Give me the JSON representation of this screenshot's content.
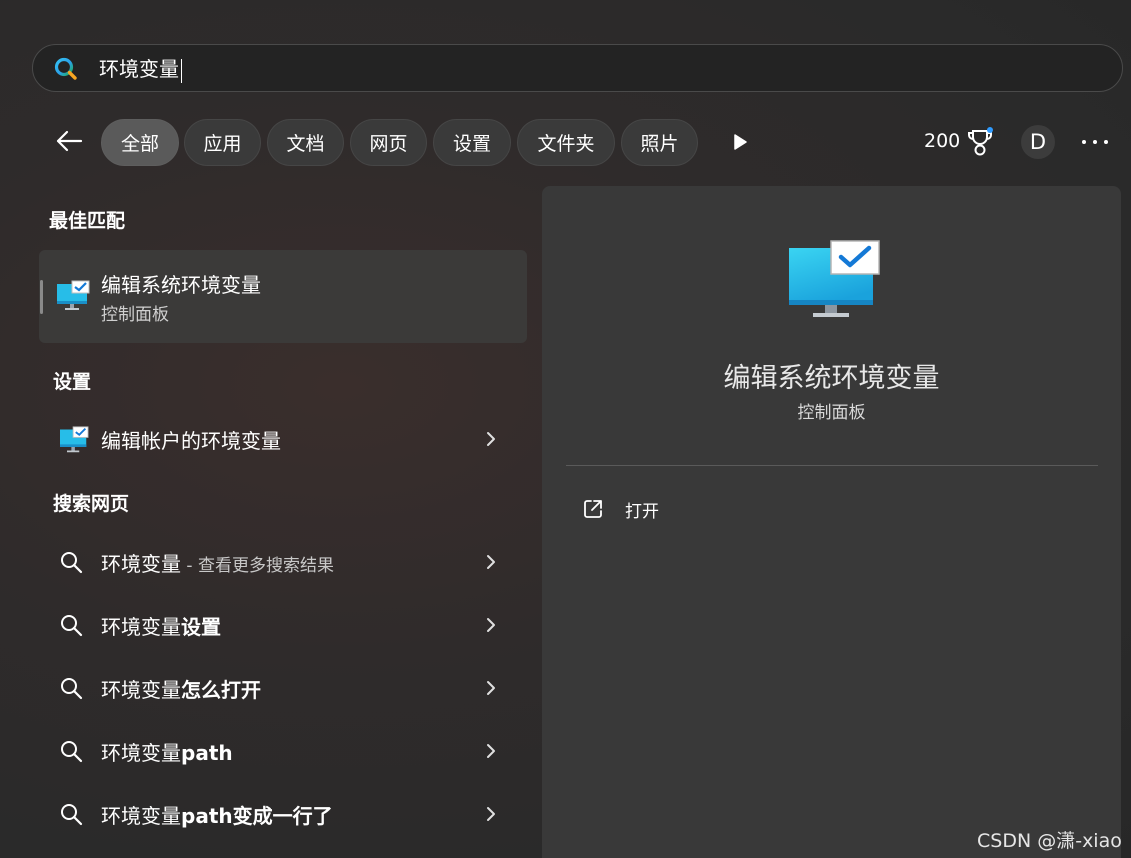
{
  "search": {
    "query": "环境变量"
  },
  "filters": {
    "tabs": [
      "全部",
      "应用",
      "文档",
      "网页",
      "设置",
      "文件夹",
      "照片"
    ],
    "active_index": 0
  },
  "header": {
    "points": "200",
    "avatar_initial": "D"
  },
  "best_match": {
    "section_title": "最佳匹配",
    "title": "编辑系统环境变量",
    "subtitle": "控制面板"
  },
  "settings": {
    "section_title": "设置",
    "items": [
      {
        "label": "编辑帐户的环境变量"
      }
    ]
  },
  "web": {
    "section_title": "搜索网页",
    "items": [
      {
        "prefix": "环境变量",
        "bold": "",
        "suffix": " - 查看更多搜索结果"
      },
      {
        "prefix": "环境变量",
        "bold": "设置",
        "suffix": ""
      },
      {
        "prefix": "环境变量",
        "bold": "怎么打开",
        "suffix": ""
      },
      {
        "prefix": "环境变量",
        "bold": "path",
        "suffix": ""
      },
      {
        "prefix": "环境变量",
        "bold": "path变成一行了",
        "suffix": ""
      }
    ]
  },
  "preview": {
    "title": "编辑系统环境变量",
    "subtitle": "控制面板",
    "actions": [
      {
        "label": "打开"
      }
    ]
  },
  "watermark": "CSDN @潇-xiao",
  "colors": {
    "accent": "#0f7fd6",
    "monitor": "#29c1ea"
  }
}
